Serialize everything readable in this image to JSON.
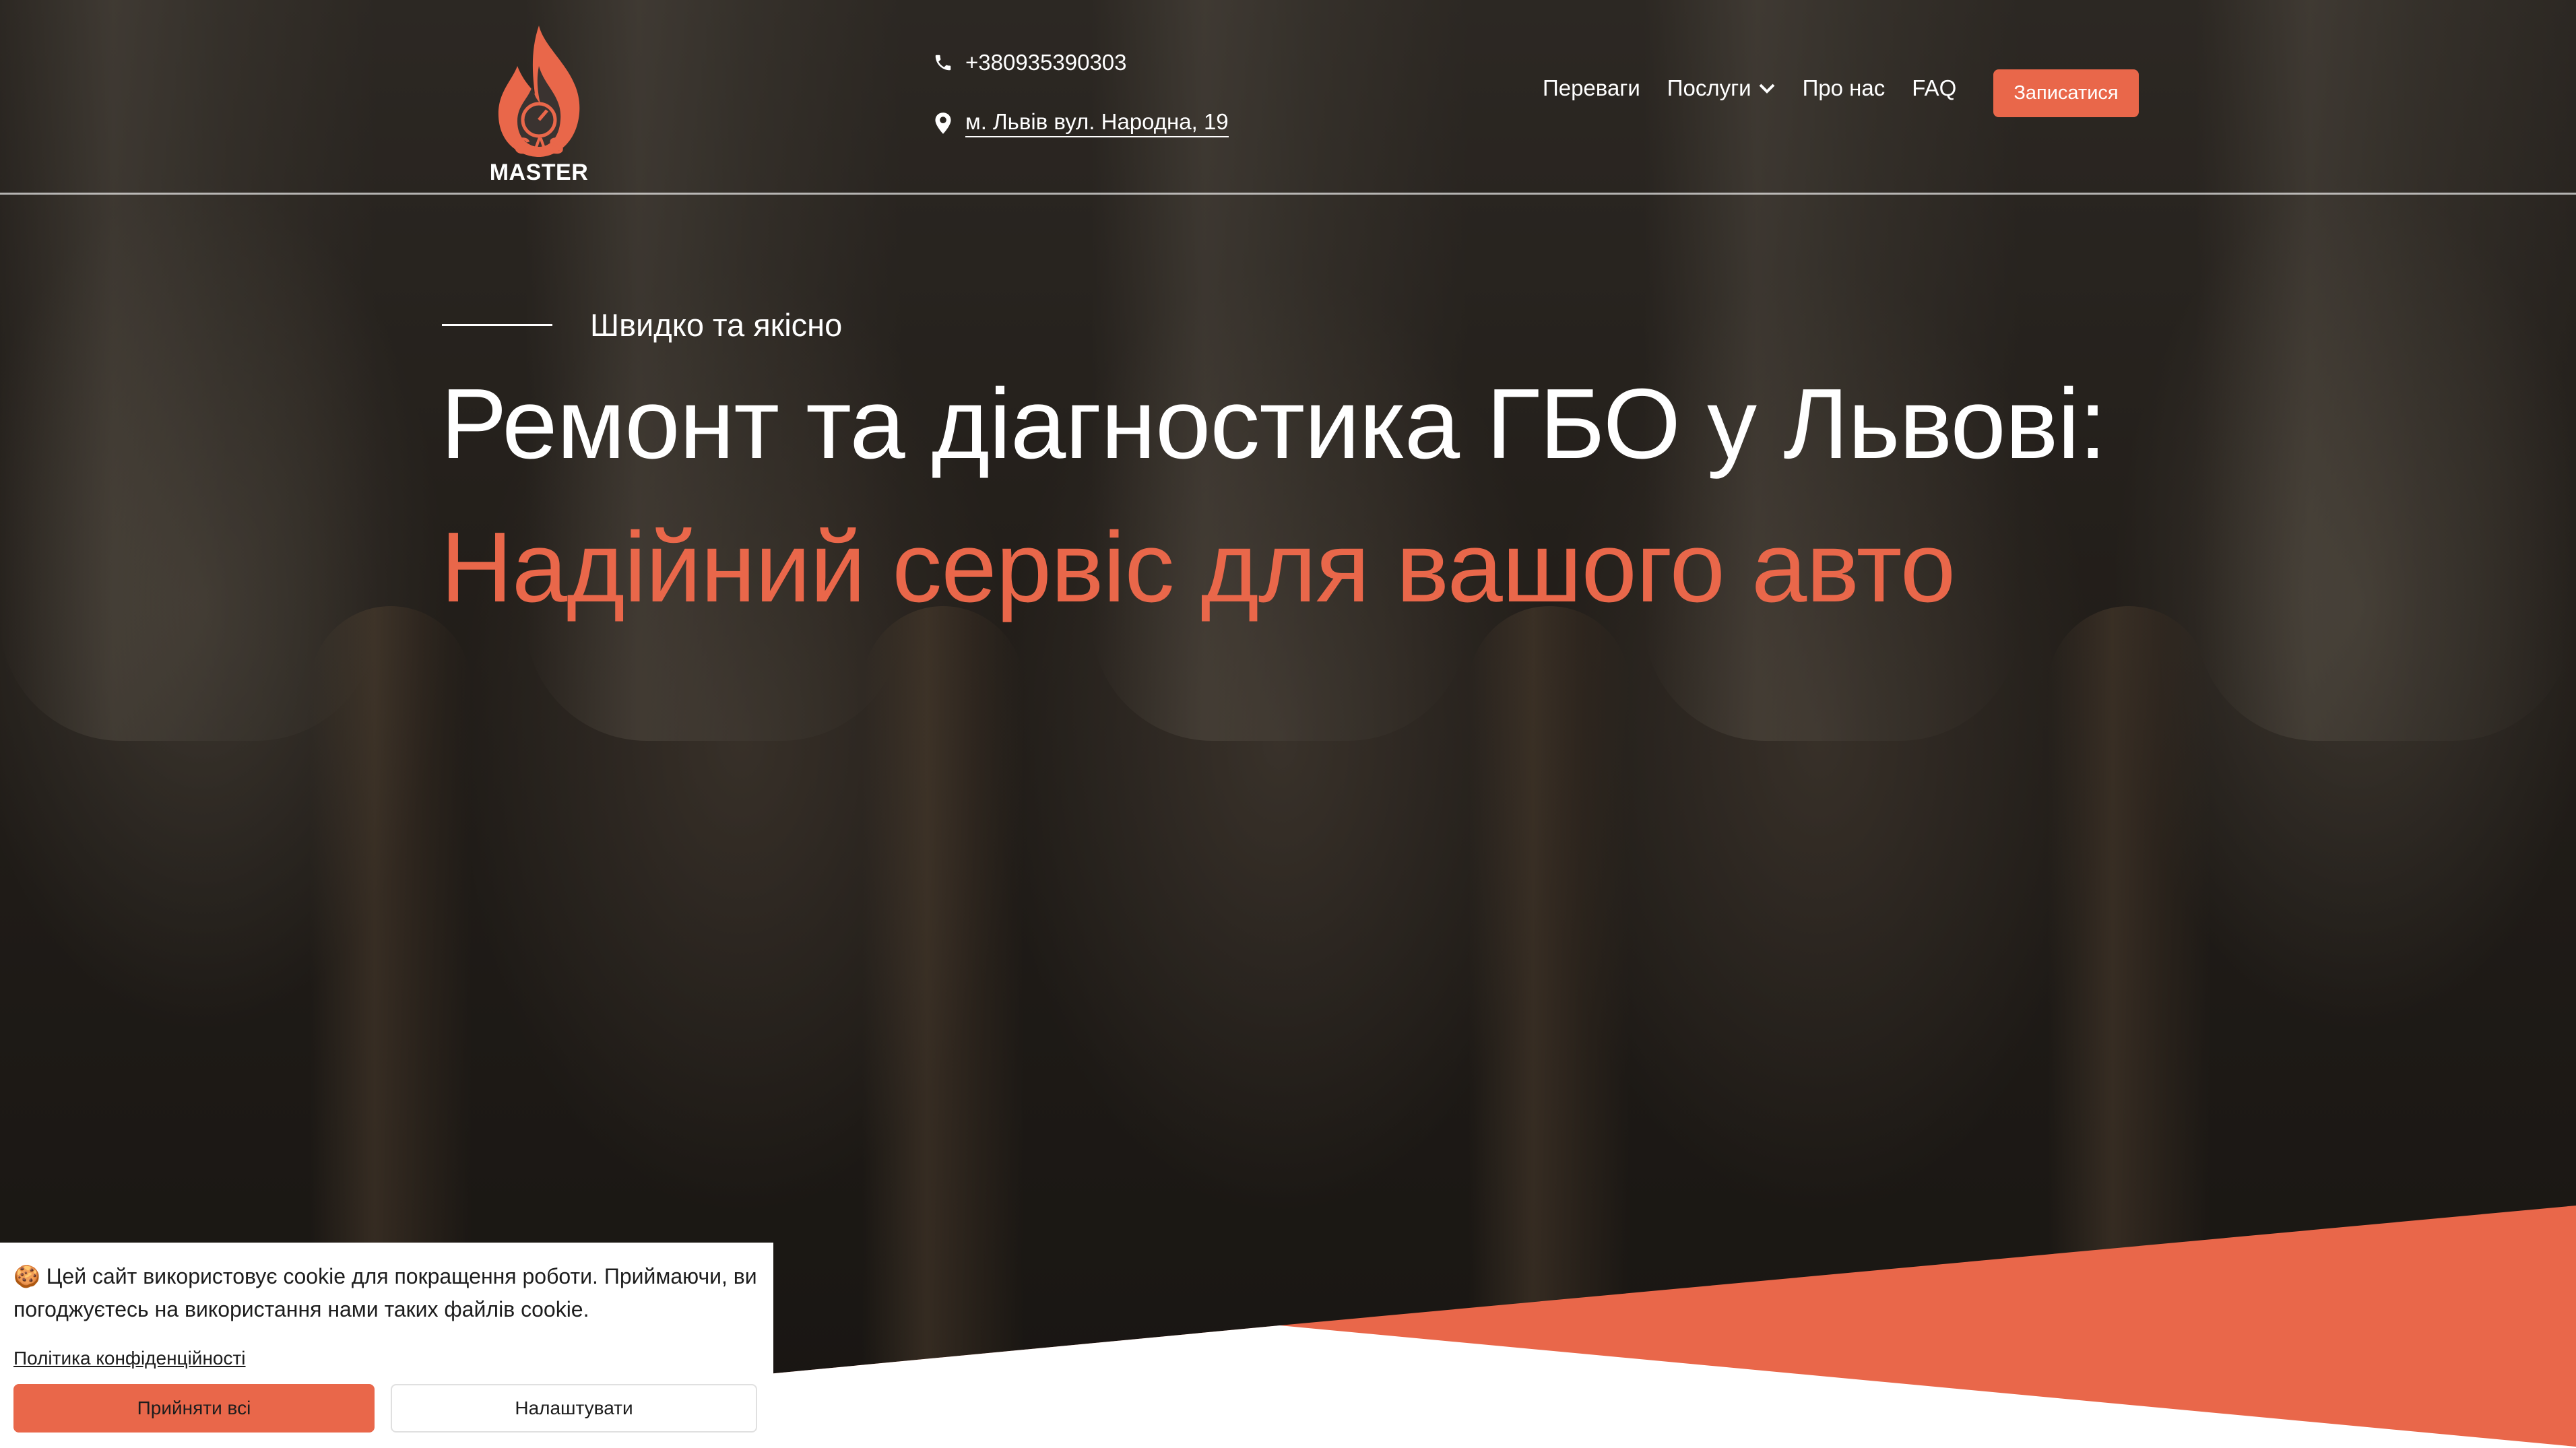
{
  "brand": {
    "logo_gas": "GAS",
    "logo_master": " MASTER",
    "accent": "#e9674a"
  },
  "header": {
    "phone": "+380935390303",
    "address": "м. Львів вул. Народна, 19",
    "nav": [
      {
        "label": "Переваги"
      },
      {
        "label": "Послуги"
      },
      {
        "label": "Про нас"
      },
      {
        "label": "FAQ"
      }
    ],
    "cta": "Записатися"
  },
  "hero": {
    "eyebrow": "Швидко та якісно",
    "title": "Ремонт та діагностика ГБО у Львові:",
    "subtitle": "Надійний сервіс для вашого авто"
  },
  "cookie": {
    "text": "🍪 Цей сайт використовує cookie для покращення роботи. Приймаючи, ви погоджуєтесь на використання нами таких файлів cookie.",
    "policy_link": "Політика конфіденційності",
    "accept_label": "Прийняти всі",
    "settings_label": "Налаштувати"
  },
  "icons": [
    "phone-icon",
    "location-pin-icon",
    "chevron-down-icon",
    "flame-logo-icon"
  ]
}
